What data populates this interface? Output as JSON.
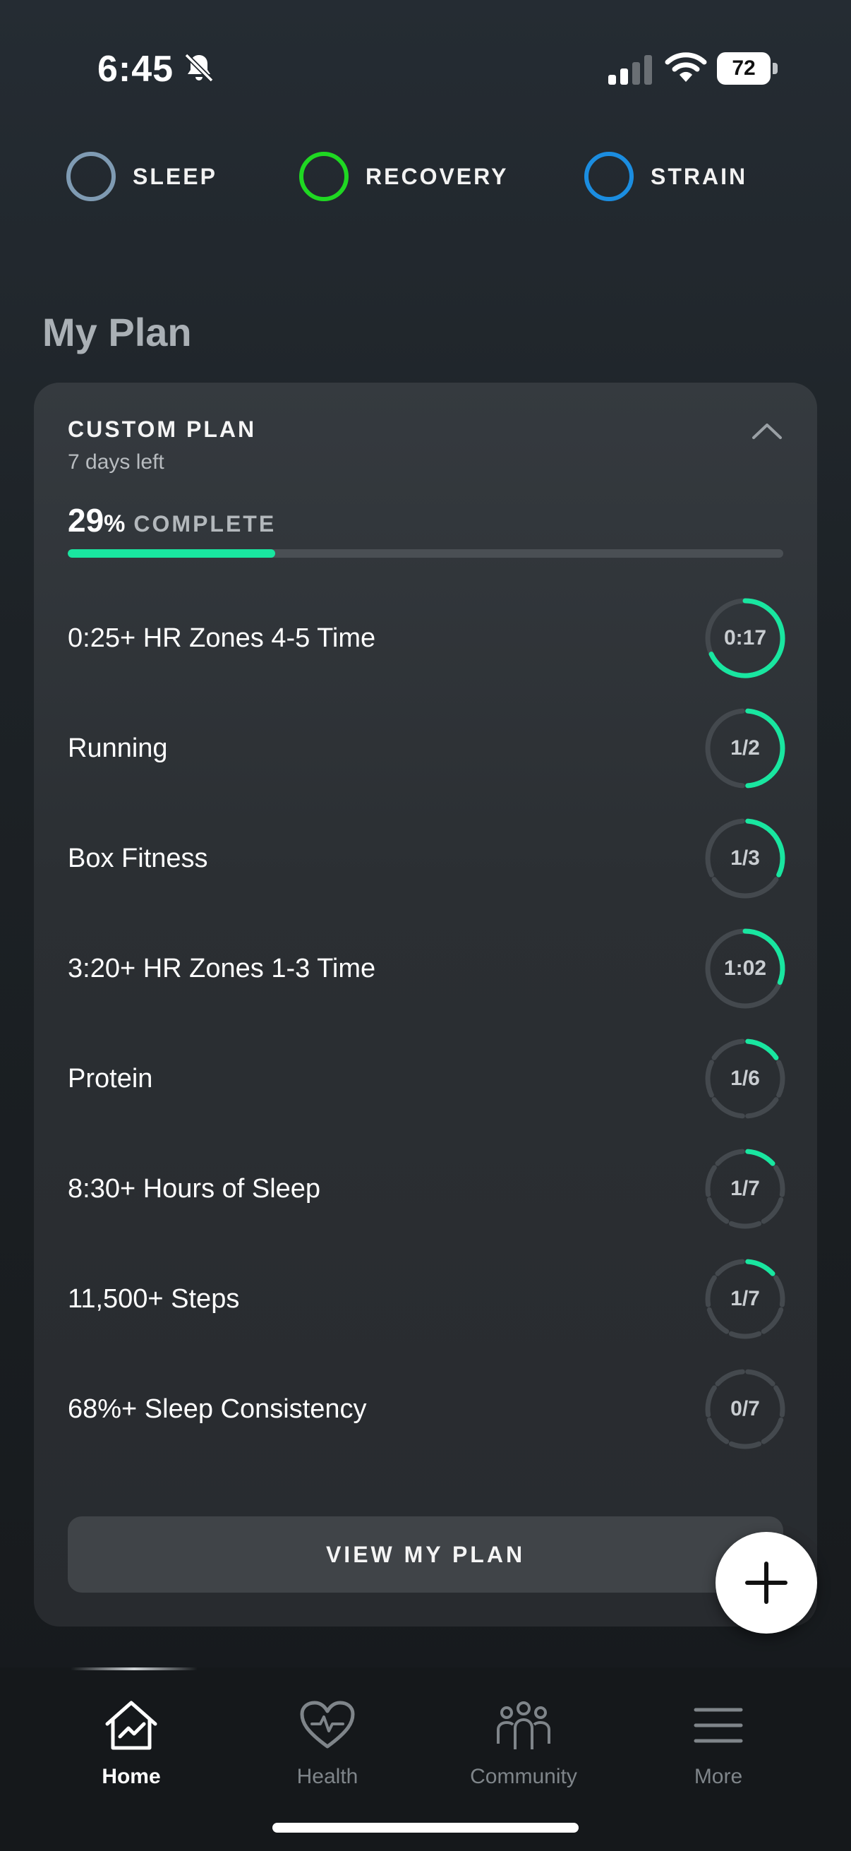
{
  "status_bar": {
    "time": "6:45",
    "battery": "72"
  },
  "metrics": [
    {
      "label": "SLEEP",
      "color": "#7f9bb3"
    },
    {
      "label": "RECOVERY",
      "color": "#1fd822"
    },
    {
      "label": "STRAIN",
      "color": "#1b8de0"
    }
  ],
  "section_title": "My Plan",
  "plan": {
    "label": "CUSTOM PLAN",
    "days_left": "7 days left",
    "percent": "29",
    "percent_symbol": "%",
    "complete_label": "COMPLETE",
    "progress_fraction": 0.29,
    "accent_color": "#19e6a0",
    "tasks": [
      {
        "name": "0:25+ HR Zones 4-5 Time",
        "value": "0:17",
        "fraction": 0.68,
        "segments": 0
      },
      {
        "name": "Running",
        "value": "1/2",
        "fraction": 0.5,
        "segments": 2
      },
      {
        "name": "Box Fitness",
        "value": "1/3",
        "fraction": 0.3333,
        "segments": 3
      },
      {
        "name": "3:20+ HR Zones 1-3 Time",
        "value": "1:02",
        "fraction": 0.31,
        "segments": 0
      },
      {
        "name": "Protein",
        "value": "1/6",
        "fraction": 0.1667,
        "segments": 6
      },
      {
        "name": "8:30+ Hours of Sleep",
        "value": "1/7",
        "fraction": 0.1429,
        "segments": 7
      },
      {
        "name": "11,500+ Steps",
        "value": "1/7",
        "fraction": 0.1429,
        "segments": 7
      },
      {
        "name": "68%+ Sleep Consistency",
        "value": "0/7",
        "fraction": 0,
        "segments": 7
      }
    ],
    "view_button": "VIEW MY PLAN"
  },
  "nav": [
    {
      "label": "Home",
      "icon": "home-chart-icon",
      "active": true
    },
    {
      "label": "Health",
      "icon": "heart-pulse-icon",
      "active": false
    },
    {
      "label": "Community",
      "icon": "people-icon",
      "active": false
    },
    {
      "label": "More",
      "icon": "menu-icon",
      "active": false
    }
  ]
}
